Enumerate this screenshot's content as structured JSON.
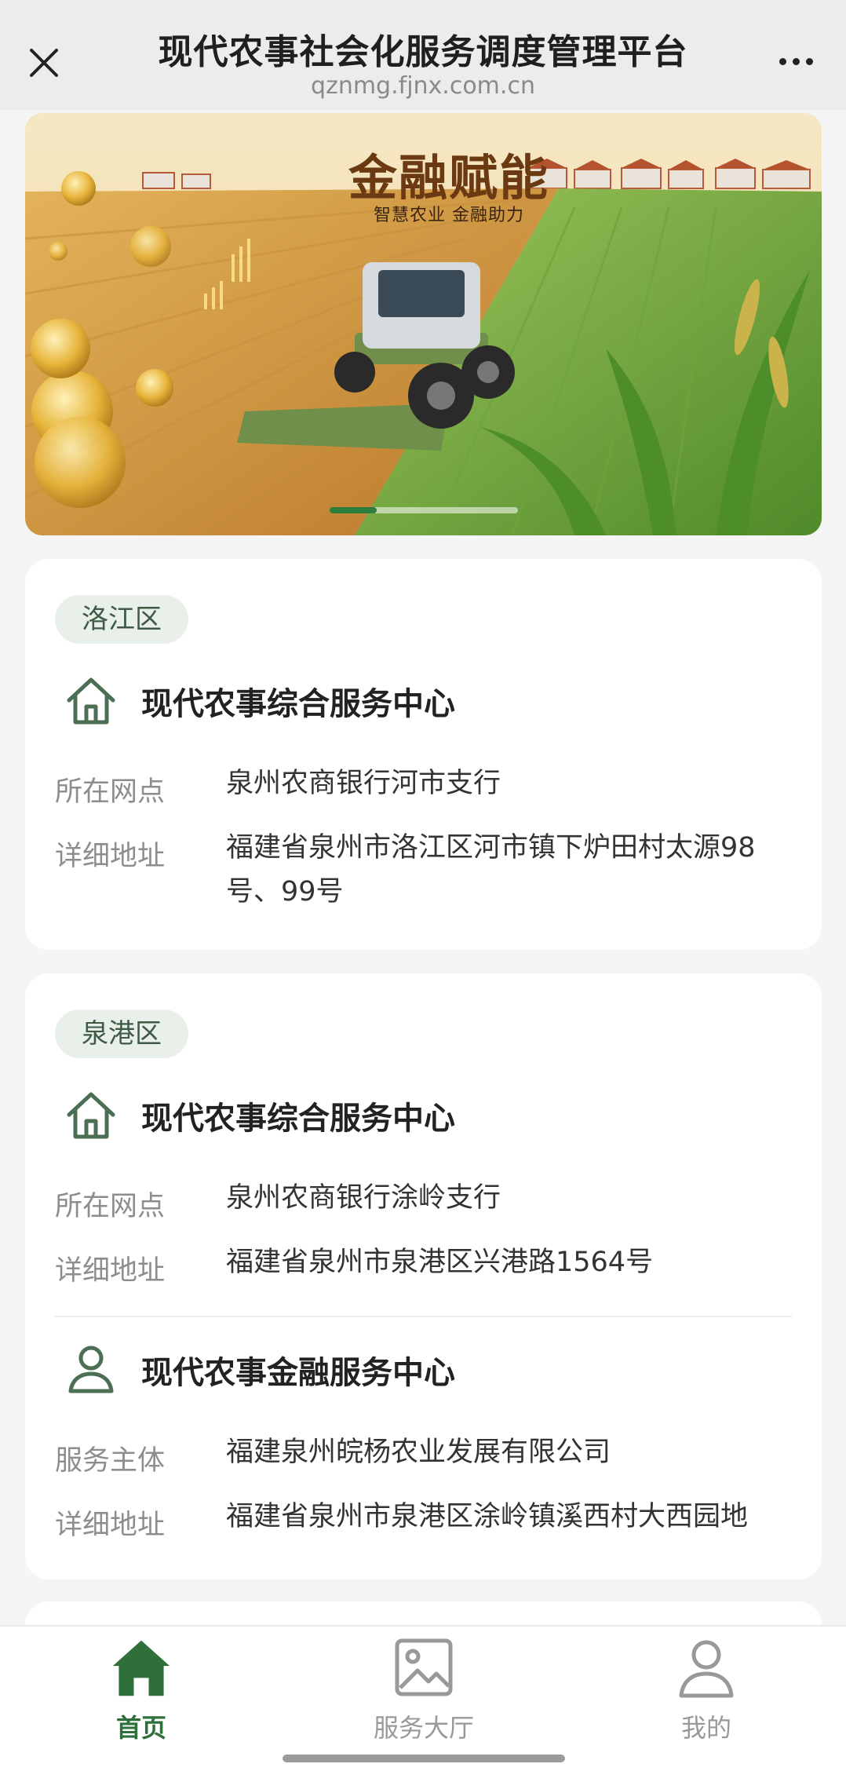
{
  "header": {
    "title": "现代农事社会化服务调度管理平台",
    "url": "qznmg.fjnx.com.cn",
    "close_icon": "close-icon",
    "more_icon": "more-icon"
  },
  "banner": {
    "headline": "金融赋能",
    "subline": "智慧农业  金融助力"
  },
  "cards": [
    {
      "district": "洛江区",
      "services": [
        {
          "icon": "house-icon",
          "title": "现代农事综合服务中心",
          "rows": [
            {
              "label": "所在网点",
              "value": "泉州农商银行河市支行"
            },
            {
              "label": "详细地址",
              "value": "福建省泉州市洛江区河市镇下炉田村太源98号、99号"
            }
          ]
        }
      ]
    },
    {
      "district": "泉港区",
      "services": [
        {
          "icon": "house-icon",
          "title": "现代农事综合服务中心",
          "rows": [
            {
              "label": "所在网点",
              "value": "泉州农商银行涂岭支行"
            },
            {
              "label": "详细地址",
              "value": "福建省泉州市泉港区兴港路1564号"
            }
          ]
        },
        {
          "icon": "person-icon",
          "title": "现代农事金融服务中心",
          "rows": [
            {
              "label": "服务主体",
              "value": "福建泉州皖杨农业发展有限公司"
            },
            {
              "label": "详细地址",
              "value": "福建省泉州市泉港区涂岭镇溪西村大西园地"
            }
          ]
        }
      ]
    }
  ],
  "nav": {
    "items": [
      {
        "label": "首页",
        "icon": "home-icon",
        "active": true
      },
      {
        "label": "服务大厅",
        "icon": "image-icon",
        "active": false
      },
      {
        "label": "我的",
        "icon": "user-icon",
        "active": false
      }
    ],
    "active_color": "#2f6f3a",
    "inactive_color": "#999999"
  }
}
